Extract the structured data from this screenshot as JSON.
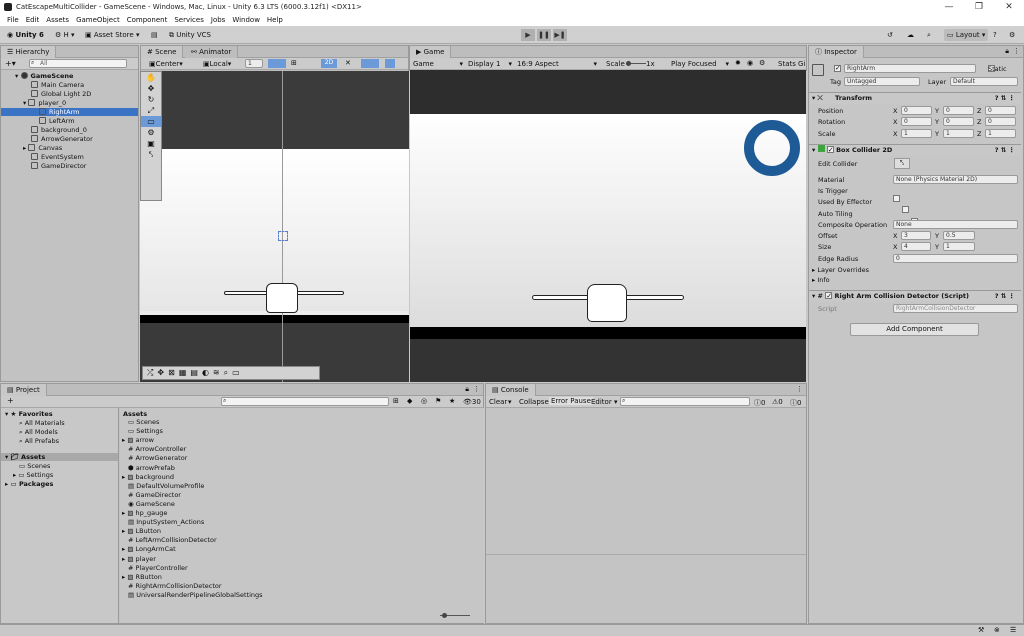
{
  "window": {
    "title": "CatEscapeMultiCollider - GameScene - Windows, Mac, Linux - Unity 6.3 LTS (6000.3.12f1) <DX11>",
    "minimize": "—",
    "maximize": "❐",
    "close": "✕"
  },
  "menu": [
    "File",
    "Edit",
    "Assets",
    "GameObject",
    "Component",
    "Services",
    "Jobs",
    "Window",
    "Help"
  ],
  "toolbar": {
    "unity_label": "Unity 6",
    "account_label": "H",
    "asset_store_label": "Asset Store",
    "vcs_label": "Unity VCS",
    "layout_label": "Layout",
    "play_icon": "play-icon",
    "pause_icon": "pause-icon",
    "step_icon": "step-icon"
  },
  "hierarchy": {
    "tab": "Hierarchy",
    "search_placeholder": "All",
    "items": [
      {
        "label": "GameScene",
        "indent": 0,
        "bold": true,
        "expanded": true
      },
      {
        "label": "Main Camera",
        "indent": 1
      },
      {
        "label": "Global Light 2D",
        "indent": 1
      },
      {
        "label": "player_0",
        "indent": 1,
        "expanded": true
      },
      {
        "label": "RightArm",
        "indent": 2,
        "selected": true
      },
      {
        "label": "LeftArm",
        "indent": 2
      },
      {
        "label": "background_0",
        "indent": 1
      },
      {
        "label": "ArrowGenerator",
        "indent": 1
      },
      {
        "label": "Canvas",
        "indent": 1,
        "collapsed": true
      },
      {
        "label": "EventSystem",
        "indent": 1
      },
      {
        "label": "GameDirector",
        "indent": 1
      }
    ]
  },
  "scene": {
    "tabs": [
      "Scene",
      "Animator"
    ],
    "pivot": "Center",
    "space": "Local",
    "snap_value": "1",
    "mode_2d": "2D"
  },
  "game": {
    "tab": "Game",
    "display_mode": "Game",
    "display": "Display 1",
    "aspect": "16:9 Aspect",
    "scale_label": "Scale",
    "scale_value": "1x",
    "play_mode": "Play Focused",
    "stats": "Stats",
    "gizmos": "Gi"
  },
  "inspector": {
    "tab": "Inspector",
    "object_name": "RightArm",
    "static_label": "Static",
    "tag_label": "Tag",
    "tag_value": "Untagged",
    "layer_label": "Layer",
    "layer_value": "Default",
    "transform": {
      "title": "Transform",
      "position_label": "Position",
      "position": [
        "0",
        "0",
        "0"
      ],
      "rotation_label": "Rotation",
      "rotation": [
        "0",
        "0",
        "0"
      ],
      "scale_label": "Scale",
      "scale": [
        "1",
        "1",
        "1"
      ]
    },
    "box_collider": {
      "title": "Box Collider 2D",
      "edit_collider": "Edit Collider",
      "material_label": "Material",
      "material_value": "None (Physics Material 2D)",
      "is_trigger": "Is Trigger",
      "used_by_effector": "Used By Effector",
      "auto_tiling": "Auto Tiling",
      "composite_label": "Composite Operation",
      "composite_value": "None",
      "offset_label": "Offset",
      "offset": [
        "3",
        "0.5"
      ],
      "size_label": "Size",
      "size": [
        "4",
        "1"
      ],
      "edge_radius_label": "Edge Radius",
      "edge_radius": "0",
      "layer_overrides": "Layer Overrides",
      "info": "Info"
    },
    "script": {
      "title": "Right Arm Collision Detector (Script)",
      "script_label": "Script",
      "script_value": "RightArmCollisionDetector"
    },
    "add_component": "Add Component"
  },
  "project": {
    "tab": "Project",
    "count": "30",
    "favorites_label": "Favorites",
    "favorites": [
      "All Materials",
      "All Models",
      "All Prefabs"
    ],
    "assets_label": "Assets",
    "asset_folders": [
      "Scenes",
      "Settings"
    ],
    "packages_label": "Packages",
    "assets_header": "Assets",
    "assets": [
      {
        "label": "Scenes",
        "icon": "folder"
      },
      {
        "label": "Settings",
        "icon": "folder"
      },
      {
        "label": "arrow",
        "icon": "sprite"
      },
      {
        "label": "ArrowController",
        "icon": "script"
      },
      {
        "label": "ArrowGenerator",
        "icon": "script"
      },
      {
        "label": "arrowPrefab",
        "icon": "prefab"
      },
      {
        "label": "background",
        "icon": "sprite"
      },
      {
        "label": "DefaultVolumeProfile",
        "icon": "asset"
      },
      {
        "label": "GameDirector",
        "icon": "script"
      },
      {
        "label": "GameScene",
        "icon": "scene"
      },
      {
        "label": "hp_gauge",
        "icon": "sprite"
      },
      {
        "label": "InputSystem_Actions",
        "icon": "asset"
      },
      {
        "label": "LButton",
        "icon": "sprite"
      },
      {
        "label": "LeftArmCollisionDetector",
        "icon": "script"
      },
      {
        "label": "LongArmCat",
        "icon": "sprite"
      },
      {
        "label": "player",
        "icon": "sprite"
      },
      {
        "label": "PlayerController",
        "icon": "script"
      },
      {
        "label": "RButton",
        "icon": "sprite"
      },
      {
        "label": "RightArmCollisionDetector",
        "icon": "script"
      },
      {
        "label": "UniversalRenderPipelineGlobalSettings",
        "icon": "asset"
      }
    ]
  },
  "console": {
    "tab": "Console",
    "clear": "Clear",
    "collapse": "Collapse",
    "error_pause": "Error Pause",
    "editor": "Editor",
    "log_count": "0",
    "warn_count": "0",
    "error_count": "0"
  },
  "colors": {
    "selection": "#3a72c4",
    "ring": "#1e5a96",
    "panel_bg": "#c2c2c2",
    "scene_bg": "#ececec"
  }
}
